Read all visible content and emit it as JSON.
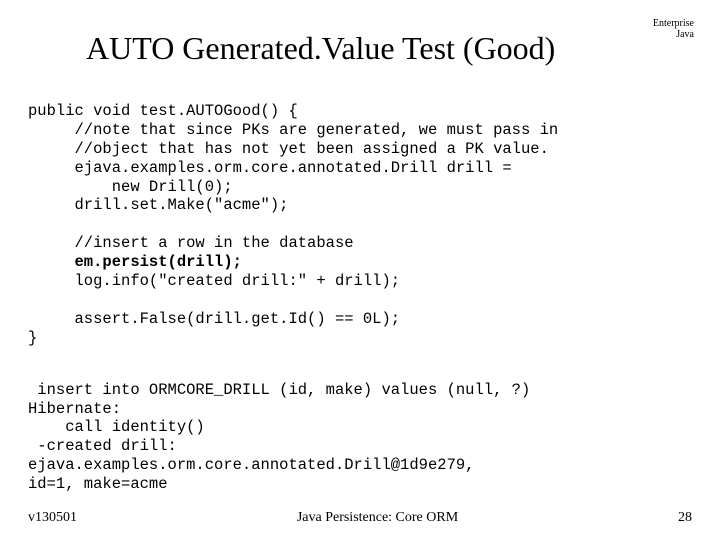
{
  "corner": {
    "line1": "Enterprise",
    "line2": "Java"
  },
  "title": "AUTO Generated.Value Test (Good)",
  "code": {
    "l1": "public void test.AUTOGood() {",
    "l2": "     //note that since PKs are generated, we must pass in",
    "l3": "     //object that has not yet been assigned a PK value.",
    "l4": "     ejava.examples.orm.core.annotated.Drill drill =",
    "l5": "         new Drill(0);",
    "l6": "     drill.set.Make(\"acme\");",
    "l7": "",
    "l8": "     //insert a row in the database",
    "l9": "     em.persist(drill);",
    "l10": "     log.info(\"created drill:\" + drill);",
    "l11": "",
    "l12": "     assert.False(drill.get.Id() == 0L);",
    "l13": "}"
  },
  "output": {
    "o1": " insert into ORMCORE_DRILL (id, make) values (null, ?)",
    "o2": "Hibernate:",
    "o3": "    call identity()",
    "o4": " -created drill:",
    "o5": "ejava.examples.orm.core.annotated.Drill@1d9e279,",
    "o6": "id=1, make=acme"
  },
  "footer": {
    "left": "v130501",
    "center": "Java Persistence: Core ORM",
    "right": "28"
  }
}
